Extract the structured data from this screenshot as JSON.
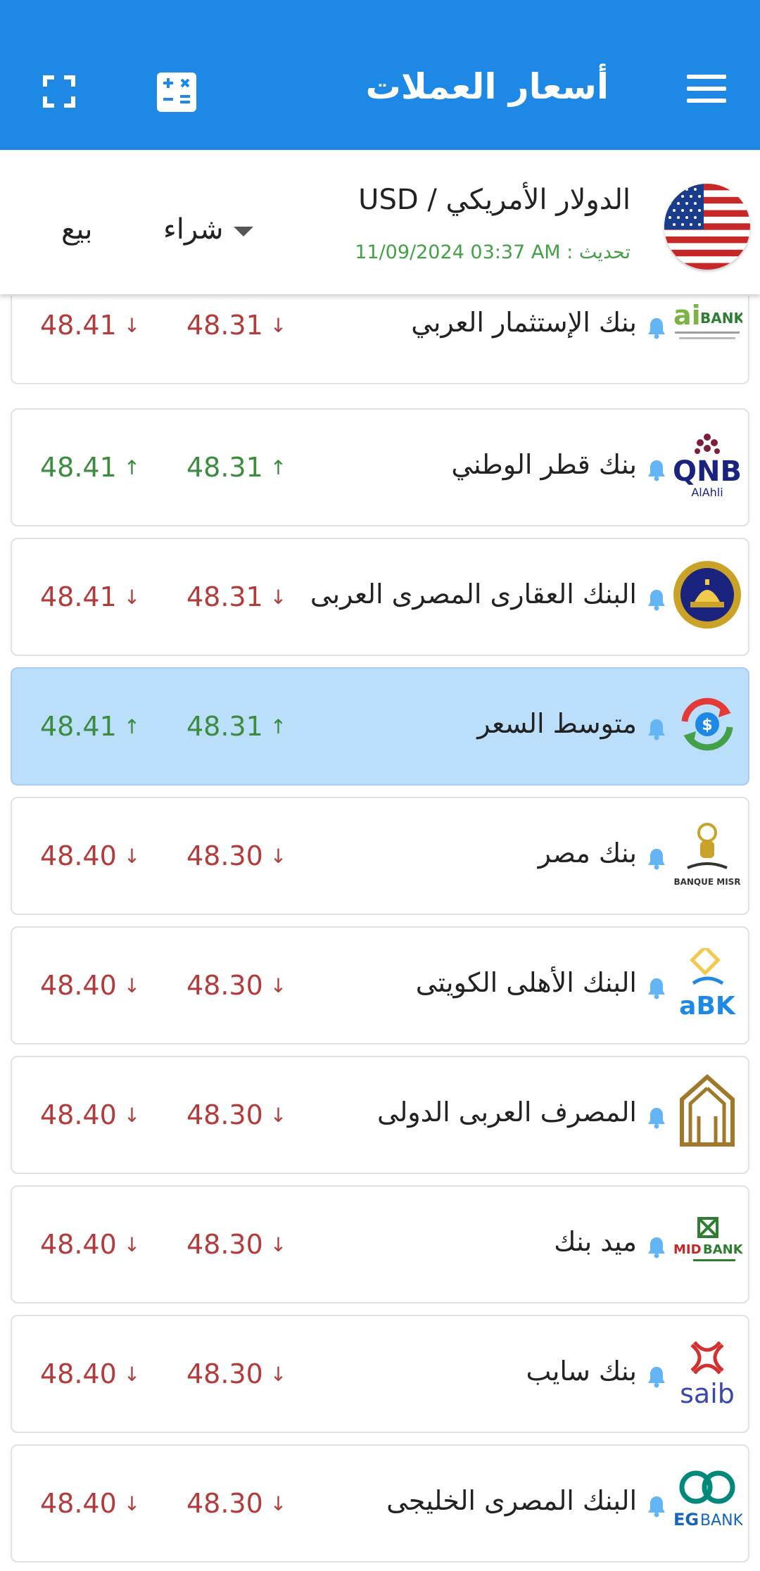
{
  "app": {
    "title": "أسعار العملات"
  },
  "currency": {
    "name": "الدولار الأمريكي / USD",
    "update_label": "تحديث :",
    "update_time": "11/09/2024 03:37 AM",
    "buy_label": "شراء",
    "sell_label": "بيع",
    "flag_icon": "us-flag-icon"
  },
  "colors": {
    "appbar": "#1e88e5",
    "up": "#3c8c3f",
    "down": "#b23b3b",
    "highlight": "#bbdefb",
    "update_text": "#43a047"
  },
  "banks": [
    {
      "name": "بنك الإستثمار العربي",
      "buy": "48.31",
      "sell": "48.41",
      "trend": "down",
      "logo": "aibank-logo"
    },
    {
      "name": "بنك قطر الوطني",
      "buy": "48.31",
      "sell": "48.41",
      "trend": "up",
      "logo": "qnb-logo"
    },
    {
      "name": "البنك العقارى المصرى العربى",
      "buy": "48.31",
      "sell": "48.41",
      "trend": "down",
      "logo": "egyptian-arab-land-bank-logo"
    },
    {
      "name": "متوسط السعر",
      "buy": "48.31",
      "sell": "48.41",
      "trend": "up",
      "logo": "average-price-icon",
      "highlight": true
    },
    {
      "name": "بنك مصر",
      "buy": "48.30",
      "sell": "48.40",
      "trend": "down",
      "logo": "banque-misr-logo"
    },
    {
      "name": "البنك الأهلى الكويتى",
      "buy": "48.30",
      "sell": "48.40",
      "trend": "down",
      "logo": "abk-logo"
    },
    {
      "name": "المصرف العربى الدولى",
      "buy": "48.30",
      "sell": "48.40",
      "trend": "down",
      "logo": "aaib-logo"
    },
    {
      "name": "ميد بنك",
      "buy": "48.30",
      "sell": "48.40",
      "trend": "down",
      "logo": "midbank-logo"
    },
    {
      "name": "بنك سايب",
      "buy": "48.30",
      "sell": "48.40",
      "trend": "down",
      "logo": "saib-logo"
    },
    {
      "name": "البنك المصرى الخليجى",
      "buy": "48.30",
      "sell": "48.40",
      "trend": "down",
      "logo": "egbank-logo"
    }
  ],
  "logo_text": {
    "aibank_ai": "ai",
    "aibank_bank": "BANK",
    "qnb": "QNB",
    "qnb_sub": "AlAhli",
    "misr": "BANQUE MISR",
    "abk": "aBK",
    "mid": "MID",
    "mid_bank": "BANK",
    "saib": "saib",
    "eg": "EG",
    "eg_bank": "BANK"
  }
}
